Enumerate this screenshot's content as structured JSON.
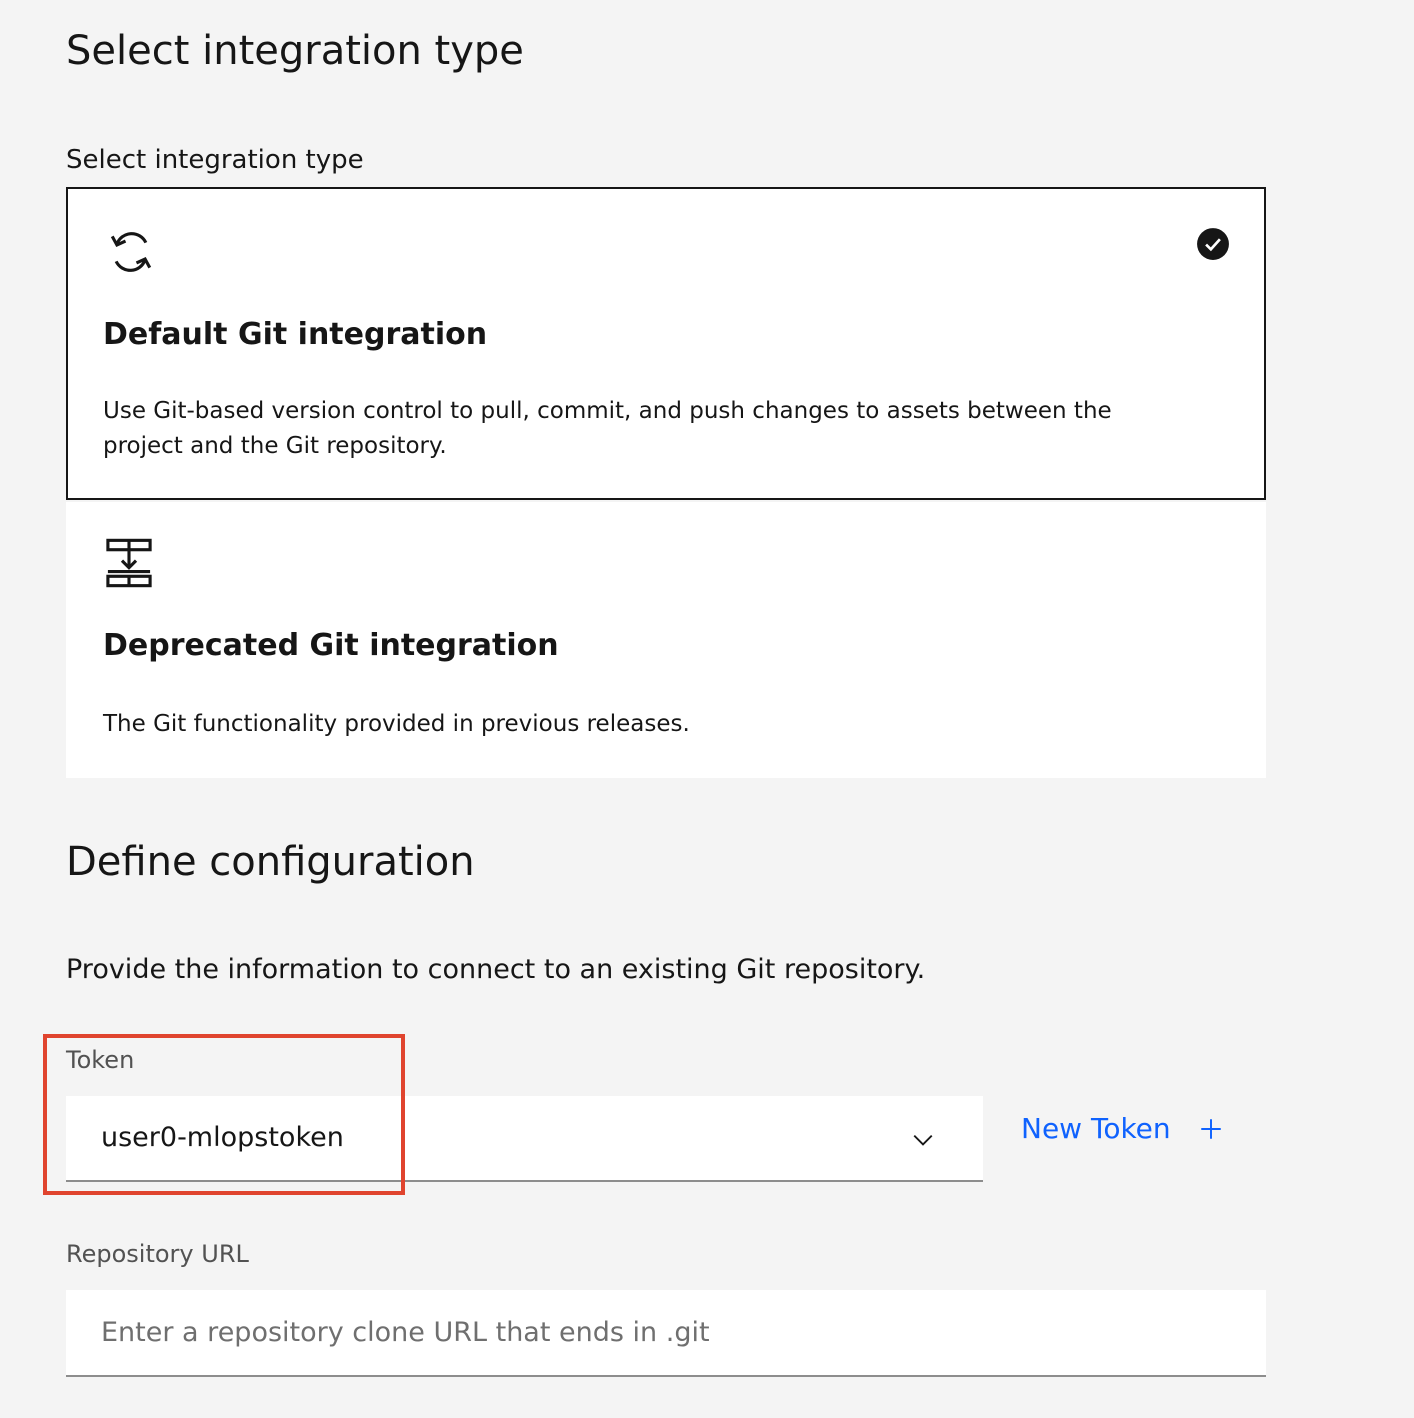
{
  "integration": {
    "section_title": "Select integration type",
    "field_label": "Select integration type",
    "options": [
      {
        "title": "Default Git integration",
        "description": "Use Git-based version control to pull, commit, and push changes to assets between the project and the Git repository.",
        "icon": "sync-arrows-icon",
        "selected": true
      },
      {
        "title": "Deprecated Git integration",
        "description": "The Git functionality provided in previous releases.",
        "icon": "data-transfer-icon",
        "selected": false
      }
    ]
  },
  "configuration": {
    "section_title": "Define configuration",
    "description": "Provide the information to connect to an existing Git repository.",
    "token": {
      "label": "Token",
      "value": "user0-mlopstoken",
      "new_token_label": "New Token"
    },
    "repository_url": {
      "label": "Repository URL",
      "placeholder": "Enter a repository clone URL that ends in .git",
      "value": ""
    }
  },
  "colors": {
    "background": "#f4f4f4",
    "link": "#0f62fe",
    "highlight": "#e0442e",
    "text": "#161616"
  }
}
